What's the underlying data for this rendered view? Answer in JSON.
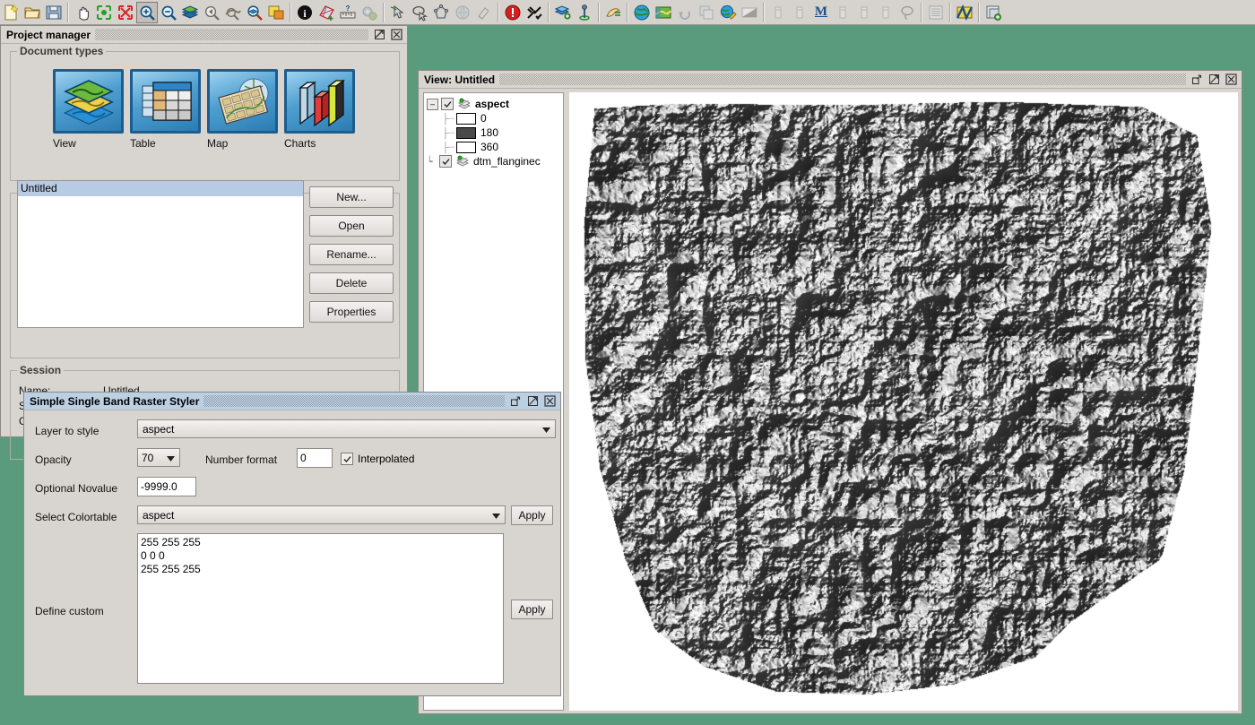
{
  "toolbar": {
    "groups": [
      {
        "buttons": [
          {
            "name": "new-project-icon",
            "title": "New"
          },
          {
            "name": "open-project-icon",
            "title": "Open"
          },
          {
            "name": "save-project-icon",
            "title": "Save"
          }
        ]
      },
      {
        "buttons": [
          {
            "name": "pan-icon",
            "title": "Pan"
          },
          {
            "name": "zoom-full-extent-icon",
            "title": "Zoom full extent"
          },
          {
            "name": "zoom-selection-icon",
            "title": "Zoom to selection"
          },
          {
            "name": "zoom-in-icon",
            "title": "Zoom in",
            "active": true
          },
          {
            "name": "zoom-out-icon",
            "title": "Zoom out"
          },
          {
            "name": "layers-icon",
            "title": "Layers"
          },
          {
            "name": "zoom-previous-icon",
            "title": "Zoom previous"
          },
          {
            "name": "zoom-next-icon",
            "title": "Zoom next"
          },
          {
            "name": "zoom-layer-icon",
            "title": "Zoom to layer"
          },
          {
            "name": "locator-icon",
            "title": "Locator"
          }
        ]
      },
      {
        "buttons": [
          {
            "name": "info-icon",
            "title": "Info"
          },
          {
            "name": "area-measure-icon",
            "title": "Measure area"
          },
          {
            "name": "distance-measure-icon",
            "title": "Measure distance"
          },
          {
            "name": "settings-icon",
            "title": "Settings",
            "disabled": true
          }
        ]
      },
      {
        "buttons": [
          {
            "name": "select-arrow-icon",
            "title": "Select"
          },
          {
            "name": "select-circle-icon",
            "title": "Select by circle"
          },
          {
            "name": "select-polygon-icon",
            "title": "Select by polygon"
          },
          {
            "name": "select-globe-icon",
            "title": "Select by area",
            "disabled": true
          },
          {
            "name": "clear-selection-icon",
            "title": "Clear selection",
            "disabled": true
          }
        ]
      },
      {
        "buttons": [
          {
            "name": "stop-icon",
            "title": "Stop"
          },
          {
            "name": "tools-icon",
            "title": "Tools"
          }
        ]
      },
      {
        "buttons": [
          {
            "name": "add-layer-icon",
            "title": "Add layer"
          },
          {
            "name": "add-point-layer-icon",
            "title": "Add point layer"
          }
        ]
      },
      {
        "buttons": [
          {
            "name": "hand-edit-icon",
            "title": "Edit"
          }
        ]
      },
      {
        "buttons": [
          {
            "name": "globe-icon",
            "title": "Globe"
          },
          {
            "name": "map-icon",
            "title": "Map"
          },
          {
            "name": "refresh-icon",
            "title": "Refresh",
            "disabled": true
          },
          {
            "name": "duplicate-icon",
            "title": "Duplicate",
            "disabled": true
          },
          {
            "name": "edit-globe-icon",
            "title": "Edit globe"
          },
          {
            "name": "gradient-icon",
            "title": "Gradient",
            "disabled": true
          }
        ]
      },
      {
        "buttons": [
          {
            "name": "raster-tool-1-icon",
            "title": "Raster tool",
            "disabled": true
          },
          {
            "name": "raster-tool-2-icon",
            "title": "Raster tool",
            "disabled": true
          },
          {
            "name": "modeler-icon",
            "title": "Modeler",
            "label": "M"
          },
          {
            "name": "raster-tool-3-icon",
            "title": "Raster tool",
            "disabled": true
          },
          {
            "name": "raster-tool-4-icon",
            "title": "Raster tool",
            "disabled": true
          },
          {
            "name": "raster-tool-5-icon",
            "title": "Raster tool",
            "disabled": true
          },
          {
            "name": "lasso-icon",
            "title": "Lasso",
            "disabled": true
          }
        ]
      },
      {
        "buttons": [
          {
            "name": "table-doc-icon",
            "title": "Table document",
            "disabled": true
          }
        ]
      },
      {
        "buttons": [
          {
            "name": "map-doc-icon",
            "title": "Map document"
          }
        ]
      },
      {
        "buttons": [
          {
            "name": "add-catalog-icon",
            "title": "Add to catalog"
          }
        ]
      }
    ]
  },
  "project_manager": {
    "title": "Project manager",
    "window_buttons": [
      {
        "name": "maximize-button",
        "glyph": "maximize"
      },
      {
        "name": "close-button",
        "glyph": "close"
      }
    ],
    "document_types": {
      "legend": "Document types",
      "tiles": [
        {
          "name": "doc-type-view",
          "label": "View",
          "icon": "layers-stack-icon"
        },
        {
          "name": "doc-type-table",
          "label": "Table",
          "icon": "table-grid-icon"
        },
        {
          "name": "doc-type-map",
          "label": "Map",
          "icon": "map-globe-icon"
        },
        {
          "name": "doc-type-charts",
          "label": "Charts",
          "icon": "bar-chart-icon"
        }
      ]
    },
    "view_group": {
      "legend": "View",
      "items": [
        {
          "label": "Untitled",
          "selected": true
        }
      ],
      "buttons": [
        {
          "name": "new-view-button",
          "label": "New..."
        },
        {
          "name": "open-view-button",
          "label": "Open"
        },
        {
          "name": "rename-view-button",
          "label": "Rename..."
        },
        {
          "name": "delete-view-button",
          "label": "Delete"
        },
        {
          "name": "properties-view-button",
          "label": "Properties"
        }
      ]
    },
    "session_group": {
      "legend": "Session",
      "rows": [
        {
          "name": "session-name",
          "label": "Name:",
          "value": "Untitled"
        },
        {
          "name": "session-saved-as",
          "label": "Saved as:",
          "value": ""
        },
        {
          "name": "session-created",
          "label": "Created:",
          "value": ""
        }
      ]
    }
  },
  "view_window": {
    "title": "View: Untitled",
    "window_buttons": [
      {
        "name": "restore-button",
        "glyph": "restore"
      },
      {
        "name": "maximize-button",
        "glyph": "maximize"
      },
      {
        "name": "close-button",
        "glyph": "close"
      }
    ],
    "layer_tree": {
      "layers": [
        {
          "name": "layer-aspect",
          "label": "aspect",
          "checked": true,
          "expanded": true,
          "bold": true,
          "classes": [
            {
              "label": "0",
              "color": "#ffffff"
            },
            {
              "label": "180",
              "color": "#494949"
            },
            {
              "label": "360",
              "color": "#ffffff"
            }
          ]
        },
        {
          "name": "layer-dtm-flanginec",
          "label": "dtm_flanginec",
          "checked": true,
          "expanded": false,
          "bold": false,
          "classes": []
        }
      ]
    }
  },
  "styler_dialog": {
    "title": "Simple Single Band Raster Styler",
    "window_buttons": [
      {
        "name": "restore-button",
        "glyph": "restore"
      },
      {
        "name": "maximize-button",
        "glyph": "maximize"
      },
      {
        "name": "close-button",
        "glyph": "close"
      }
    ],
    "fields": {
      "layer_to_style_label": "Layer to style",
      "layer_to_style_value": "aspect",
      "opacity_label": "Opacity",
      "opacity_value": "70",
      "number_format_label": "Number format",
      "number_format_value": "0",
      "interpolated_label": "Interpolated",
      "interpolated_checked": true,
      "optional_novalue_label": "Optional Novalue",
      "optional_novalue_value": "-9999.0",
      "select_colortable_label": "Select Colortable",
      "select_colortable_value": "aspect",
      "apply_colortable_label": "Apply",
      "define_custom_label": "Define custom",
      "define_custom_value": "255 255 255\n0 0 0\n255 255 255",
      "apply_custom_label": "Apply"
    }
  },
  "colors": {
    "desktop": "#5a9b7d",
    "chrome": "#d8d4cf",
    "active_title": "#bcd0e4",
    "selection": "#b9cbe3"
  }
}
